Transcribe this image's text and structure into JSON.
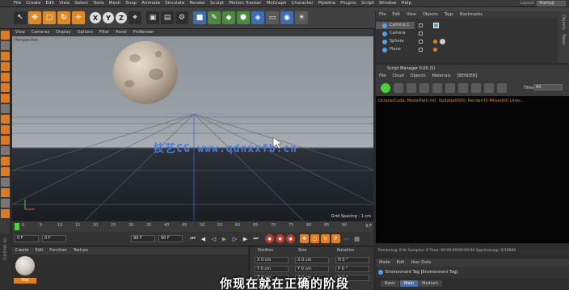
{
  "menubar": {
    "items": [
      "File",
      "Create",
      "Edit",
      "View",
      "Select",
      "Tools",
      "Mesh",
      "Snap",
      "Animate",
      "Simulate",
      "Render",
      "Sculpt",
      "Motion Tracker",
      "MoGraph",
      "Character",
      "Pipeline",
      "Plugins",
      "Script",
      "Window",
      "Help"
    ],
    "layout_label": "Layout:",
    "layout_value": "Startup"
  },
  "toolbar": {
    "axis_x": "X",
    "axis_y": "Y",
    "axis_z": "Z"
  },
  "viewport": {
    "menu": [
      "View",
      "Cameras",
      "Display",
      "Options",
      "Filter",
      "Panel",
      "ProRender"
    ],
    "title": "Perspective",
    "watermark": "技艺CG  www.qdnxxfb.cn",
    "grid_spacing": "Grid Spacing : 1 cm"
  },
  "timeline": {
    "ticks": [
      "0",
      "5",
      "10",
      "15",
      "20",
      "25",
      "30",
      "35",
      "40",
      "45",
      "50",
      "55",
      "60",
      "65",
      "70",
      "75",
      "80",
      "85",
      "90"
    ],
    "frame_end": "0 F"
  },
  "transport": {
    "start_field": "0 F",
    "current_field": "0 F",
    "end_field": "90 F",
    "end_field2": "90 F"
  },
  "materials": {
    "menu": [
      "Create",
      "Edit",
      "Function",
      "Texture"
    ],
    "material_name": "Mat"
  },
  "coordinates": {
    "headers": [
      "Position",
      "Size",
      "Rotation"
    ],
    "rows": [
      [
        "X  0 cm",
        "X  0 cm",
        "H  0 °"
      ],
      [
        "Y  0 cm",
        "Y  0 cm",
        "P  0 °"
      ],
      [
        "Z  0 cm",
        "Z  0 cm",
        "B  0 °"
      ]
    ]
  },
  "object_manager": {
    "menu": [
      "File",
      "Edit",
      "View",
      "Objects",
      "Tags",
      "Bookmarks"
    ],
    "objects": [
      "Camera.1",
      "Camera",
      "Sphere",
      "Plane"
    ]
  },
  "right_tabs": [
    "Objects",
    "Takes",
    "Content Browser"
  ],
  "console": {
    "title": "Script Manager 0.00 (S)",
    "menu": [
      "File",
      "Cloud",
      "Objects",
      "Materials",
      "[RENDER]"
    ],
    "filter_label": "Filter",
    "filter_value": "All",
    "text": "Octane/Cuda: ModelPath.Init. Updated(0/0), Render(0) Moved(0) Lines..."
  },
  "status": {
    "text": "Rendering: 0.0s  Samples: 0  Time: 00:00:00/00:00:00  Spp/maxspp: 0/16000"
  },
  "attributes": {
    "menu": [
      "Mode",
      "Edit",
      "User Data"
    ],
    "object_label": "Environment Tag [Environment Tag]",
    "tabs": [
      "Basic",
      "Main",
      "Medium"
    ]
  },
  "subtitle": "你现在就在正确的阶段",
  "cinema_label": "CINEMA 4D"
}
